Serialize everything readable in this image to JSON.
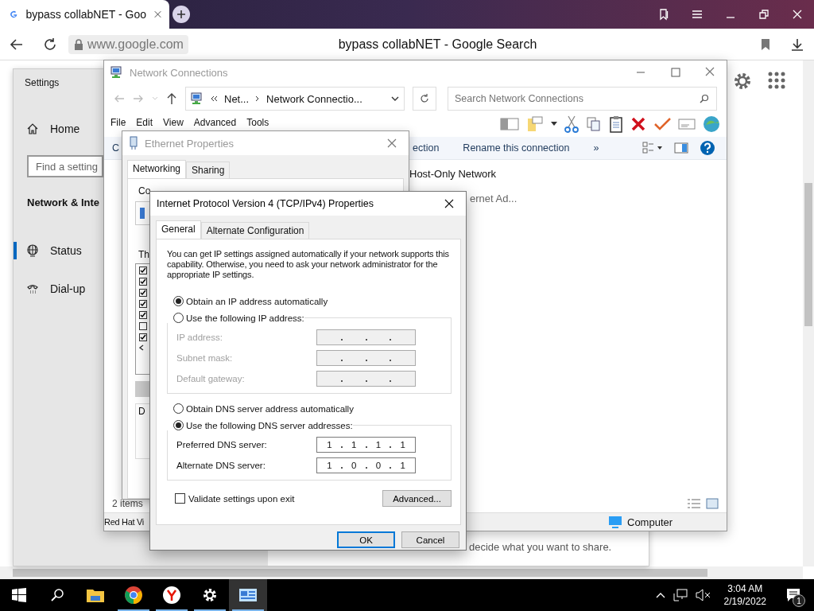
{
  "browser": {
    "tab": {
      "title": "bypass collabNET - Goo"
    },
    "url": "www.google.com",
    "page_title": "bypass collabNET - Google Search"
  },
  "settings": {
    "title": "Settings",
    "home": "Home",
    "search": {
      "placeholder": "Find a setting"
    },
    "section": "Network & Inte",
    "items": [
      {
        "label": "Status",
        "kind": "globe",
        "selected": true
      },
      {
        "label": "Dial-up",
        "kind": "phone",
        "selected": false
      }
    ],
    "content_text": "decide what you want to share."
  },
  "network_connections": {
    "title": "Network Connections",
    "breadcrumb": [
      "Net...",
      "Network Connectio..."
    ],
    "search": {
      "placeholder": "Search Network Connections"
    },
    "menu": [
      "File",
      "Edit",
      "View",
      "Advanced",
      "Tools"
    ],
    "commands": [
      "C",
      "ection",
      "Rename this connection",
      "»"
    ],
    "items": [
      "Host-Only Network",
      "ernet Ad..."
    ],
    "item_count": "2 items",
    "status_left": "Red Hat Vi",
    "status_right": "Computer"
  },
  "ethernet": {
    "title": "Ethernet Properties",
    "tabs": [
      {
        "label": "Networking",
        "selected": true
      },
      {
        "label": "Sharing",
        "selected": false
      }
    ],
    "connect_label": "Co",
    "list_label": "Th",
    "components": [
      {
        "checked": true
      },
      {
        "checked": true
      },
      {
        "checked": true
      },
      {
        "checked": true
      },
      {
        "checked": true
      },
      {
        "checked": false
      },
      {
        "checked": true
      }
    ],
    "frame_label": "D"
  },
  "ipv4": {
    "title": "Internet Protocol Version 4 (TCP/IPv4) Properties",
    "tabs": [
      {
        "label": "General",
        "selected": true
      },
      {
        "label": "Alternate Configuration",
        "selected": false
      }
    ],
    "intro": "You can get IP settings assigned automatically if your network supports this capability. Otherwise, you need to ask your network administrator for the appropriate IP settings.",
    "ip_auto": {
      "label": "Obtain an IP address automatically",
      "selected": true
    },
    "ip_manual": {
      "label": "Use the following IP address:",
      "selected": false,
      "disabled": true,
      "fields": [
        {
          "label": "IP address:"
        },
        {
          "label": "Subnet mask:"
        },
        {
          "label": "Default gateway:"
        }
      ]
    },
    "dns_auto": {
      "label": "Obtain DNS server address automatically",
      "selected": false
    },
    "dns_manual": {
      "label": "Use the following DNS server addresses:",
      "selected": true,
      "disabled": false,
      "fields": [
        {
          "label": "Preferred DNS server:",
          "octets": [
            "1",
            "1",
            "1",
            "1"
          ]
        },
        {
          "label": "Alternate DNS server:",
          "octets": [
            "1",
            "0",
            "0",
            "1"
          ]
        }
      ]
    },
    "validate": {
      "label": "Validate settings upon exit",
      "checked": false
    },
    "advanced": "Advanced...",
    "buttons": [
      {
        "label": "OK",
        "default": true
      },
      {
        "label": "Cancel",
        "default": false
      }
    ]
  },
  "taskbar": {
    "apps": [
      {
        "kind": "explorer",
        "running": false,
        "active": false
      },
      {
        "kind": "chrome",
        "running": true,
        "active": false
      },
      {
        "kind": "yandex",
        "running": true,
        "active": false
      },
      {
        "kind": "settings",
        "running": true,
        "active": false
      },
      {
        "kind": "network",
        "running": true,
        "active": true
      }
    ],
    "time": "3:04 AM",
    "date": "2/19/2022",
    "notifications": "1"
  }
}
